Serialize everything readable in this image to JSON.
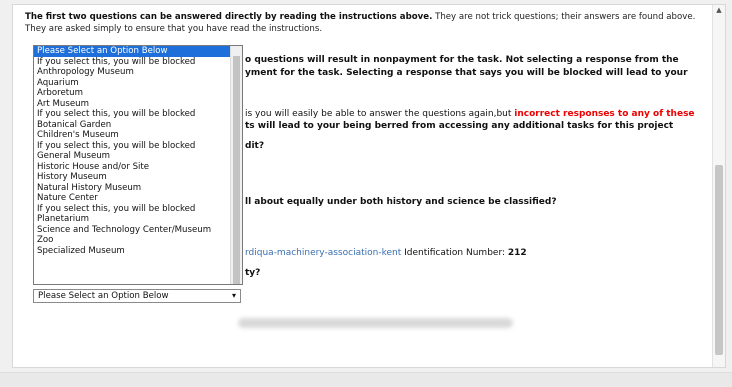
{
  "intro": {
    "bold": "The first two questions can be answered directly by reading the instructions above.",
    "rest": " They are not trick questions; their answers are found above. They are asked simply to ensure that you have read the instructions."
  },
  "warnings": {
    "line1": "o questions will result in nonpayment for the task. Not selecting a response from the",
    "line2": "yment for the task. Selecting a response that says you will be blocked will lead to your",
    "line3_plain": "is you will easily be able to answer the questions again,but ",
    "line3_red": "incorrect responses to any of these",
    "line4": "ts will lead to your being berred from accessing any additional tasks for this project"
  },
  "questions": {
    "q_credit": "dit?",
    "q_history_science": "ll about equally under both history and science be classified?",
    "q_city": "ty?"
  },
  "record": {
    "link_text": "rdiqua-machinery-association-kent",
    "id_label": "Identification Number:",
    "id_value": "212"
  },
  "dropdown": {
    "selected_value": "Please Select an Option Below",
    "options": [
      "Please Select an Option Below",
      "If you select this, you will be blocked",
      "Anthropology Museum",
      "Aquarium",
      "Arboretum",
      "Art Museum",
      "If you select this, you will be blocked",
      "Botanical Garden",
      "Children's Museum",
      "If you select this, you will be blocked",
      "General Museum",
      "Historic House and/or Site",
      "History Museum",
      "Natural History Museum",
      "Nature Center",
      "If you select this, you will be blocked",
      "Planetarium",
      "Science and Technology Center/Museum",
      "Zoo",
      "Specialized Museum"
    ]
  },
  "icons": {
    "chevron": "chevron-down-icon",
    "scroll_up": "scroll-up-arrow-icon"
  },
  "colors": {
    "warning": "#ee0000",
    "selected_bg": "#1e6fd9",
    "link": "#3a6fb0"
  }
}
